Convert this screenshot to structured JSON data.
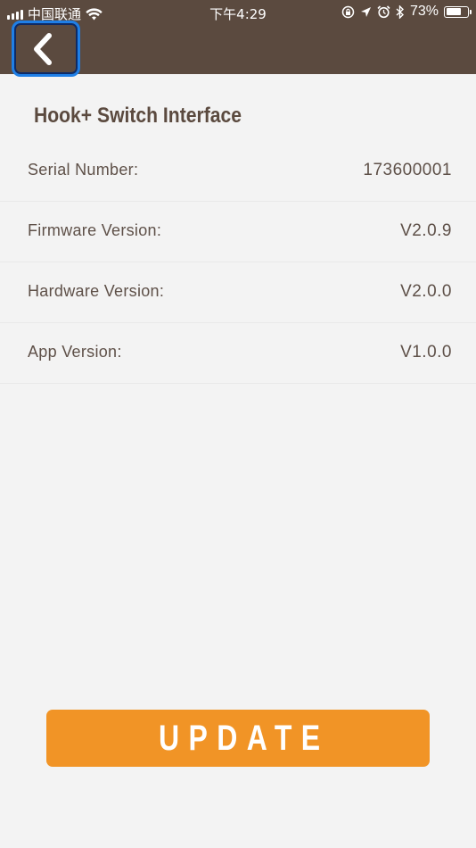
{
  "status_bar": {
    "carrier": "中国联通",
    "time": "下午4:29",
    "battery_percent": "73%",
    "battery_level": 0.73,
    "icons": [
      "signal-icon",
      "wifi-icon",
      "screen-lock-icon",
      "location-icon",
      "alarm-icon",
      "bluetooth-icon",
      "battery-icon"
    ]
  },
  "header": {
    "back_icon": "chevron-left-icon"
  },
  "page": {
    "title": "Hook+ Switch Interface"
  },
  "info_rows": [
    {
      "label": "Serial Number:",
      "value": "173600001"
    },
    {
      "label": "Firmware Version:",
      "value": "V2.0.9"
    },
    {
      "label": "Hardware Version:",
      "value": "V2.0.0"
    },
    {
      "label": "App Version:",
      "value": "V1.0.0"
    }
  ],
  "actions": {
    "update_label": "UPDATE"
  },
  "colors": {
    "header_bg": "#5b4a3f",
    "accent": "#f19426",
    "focus_ring": "#1f7fe6",
    "background": "#f3f3f3",
    "text": "#5e5048"
  }
}
